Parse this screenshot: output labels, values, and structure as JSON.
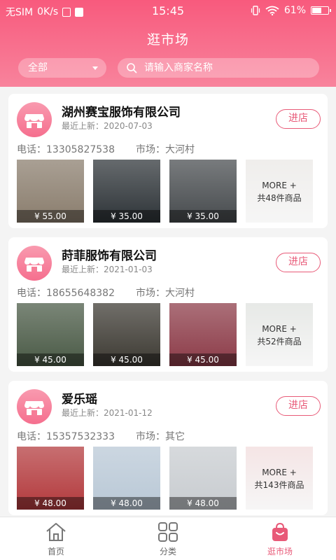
{
  "status_bar": {
    "carrier": "无SIM",
    "speed": "0K/s",
    "time": "15:45",
    "battery": "61%",
    "battery_level": 0.61
  },
  "header": {
    "title": "逛市场",
    "filter_label": "全部",
    "search_placeholder": "请输入商家名称"
  },
  "labels": {
    "recent_prefix": "最近上新：",
    "phone_prefix": "电话：",
    "market_prefix": "市场：",
    "enter_button": "进店",
    "more": "MORE +"
  },
  "shops": [
    {
      "name": "湖州赛宝服饰有限公司",
      "recent": "最近上新：2020-07-03",
      "phone": "电话：13305827538",
      "market": "市场：大河村",
      "products": [
        {
          "price": "¥ 55.00",
          "color": "#8a7d6d"
        },
        {
          "price": "¥ 35.00",
          "color": "#2e3438"
        },
        {
          "price": "¥ 35.00",
          "color": "#474b4e"
        }
      ],
      "more_count": "共48件商品"
    },
    {
      "name": "莳菲服饰有限公司",
      "recent": "最近上新：2021-01-03",
      "phone": "电话：18655648382",
      "market": "市场：大河村",
      "products": [
        {
          "price": "¥ 45.00",
          "color": "#4a5a46"
        },
        {
          "price": "¥ 45.00",
          "color": "#3d3a33"
        },
        {
          "price": "¥ 45.00",
          "color": "#8c3b48"
        }
      ],
      "more_count": "共52件商品"
    },
    {
      "name": "爱乐瑶",
      "recent": "最近上新：2021-01-12",
      "phone": "电话：15357532333",
      "market": "市场：其它",
      "products": [
        {
          "price": "¥ 48.00",
          "color": "#b33a3d"
        },
        {
          "price": "¥ 48.00",
          "color": "#b9c8d6"
        },
        {
          "price": "¥ 48.00",
          "color": "#c8ccd0"
        }
      ],
      "more_count": "共143件商品"
    }
  ],
  "bottom_nav": [
    {
      "label": "首页",
      "icon": "home-icon",
      "active": false
    },
    {
      "label": "分类",
      "icon": "grid-icon",
      "active": false
    },
    {
      "label": "逛市场",
      "icon": "shopping-bag-icon",
      "active": true
    }
  ],
  "colors": {
    "brand": "#f85a7d",
    "accent": "#e85a78",
    "nav_inactive": "#666666"
  }
}
